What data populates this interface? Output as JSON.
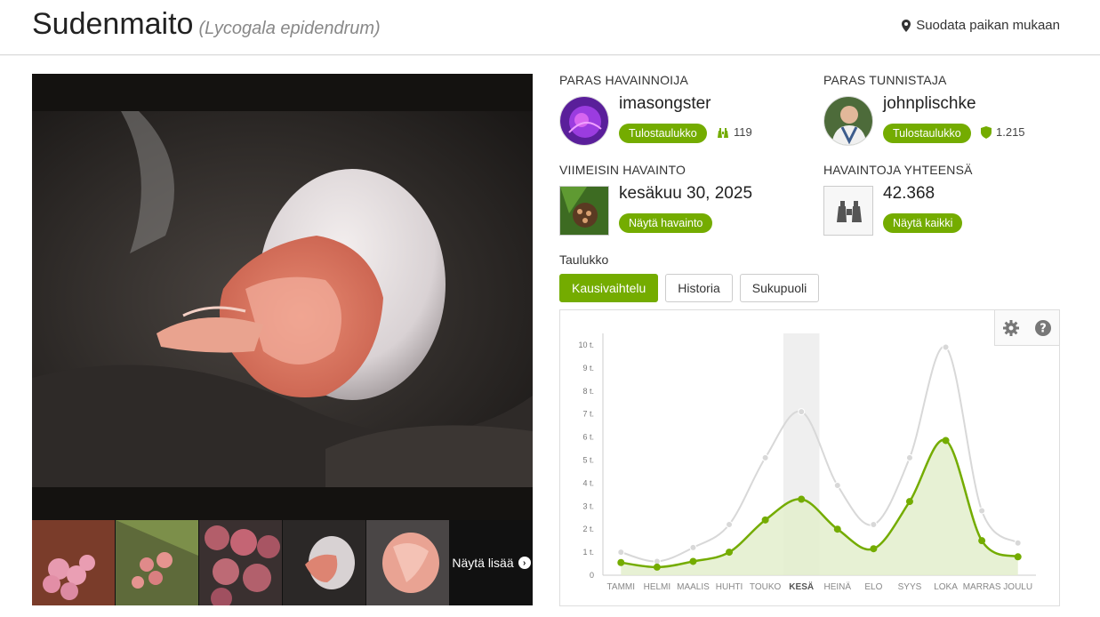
{
  "header": {
    "common_name": "Sudenmaito",
    "scientific_name": "(Lycogala epidendrum)",
    "place_filter": "Suodata paikan mukaan"
  },
  "stats": {
    "top_observer": {
      "label": "PARAS HAVAINNOIJA",
      "name": "imasongster",
      "button": "Tulostaulukko",
      "count": "119"
    },
    "top_identifier": {
      "label": "PARAS TUNNISTAJA",
      "name": "johnplischke",
      "button": "Tulostaulukko",
      "count": "1.215"
    },
    "latest": {
      "label": "VIIMEISIN HAVAINTO",
      "date": "kesäkuu 30, 2025",
      "button": "Näytä havainto"
    },
    "total": {
      "label": "HAVAINTOJA YHTEENSÄ",
      "value": "42.368",
      "button": "Näytä kaikki"
    }
  },
  "photos": {
    "more_label": "Näytä lisää"
  },
  "chart_section": {
    "label": "Taulukko",
    "tabs": [
      "Kausivaihtelu",
      "Historia",
      "Sukupuoli"
    ],
    "active_tab": 0
  },
  "colors": {
    "accent": "#74ac00",
    "grey_series": "#d8d8d8",
    "fill": "#e3efcc"
  },
  "chart_data": {
    "type": "line",
    "categories": [
      "TAMMI",
      "HELMI",
      "MAALIS",
      "HUHTI",
      "TOUKO",
      "KESÄ",
      "HEINÄ",
      "ELO",
      "SYYS",
      "LOKA",
      "MARRAS",
      "JOULU"
    ],
    "highlight_category": "KESÄ",
    "yticks": [
      "0",
      "1 t.",
      "2 t.",
      "3 t.",
      "4 t.",
      "5 t.",
      "6 t.",
      "7 t.",
      "8 t.",
      "9 t.",
      "10 t."
    ],
    "ylim": [
      0,
      10.5
    ],
    "series": [
      {
        "values": [
          1.0,
          0.6,
          1.2,
          2.2,
          5.1,
          7.1,
          3.9,
          2.2,
          5.1,
          9.9,
          2.8,
          1.4
        ]
      },
      {
        "values": [
          0.55,
          0.35,
          0.6,
          1.0,
          2.4,
          3.3,
          2.0,
          1.15,
          3.2,
          5.85,
          1.5,
          0.8
        ]
      }
    ]
  }
}
